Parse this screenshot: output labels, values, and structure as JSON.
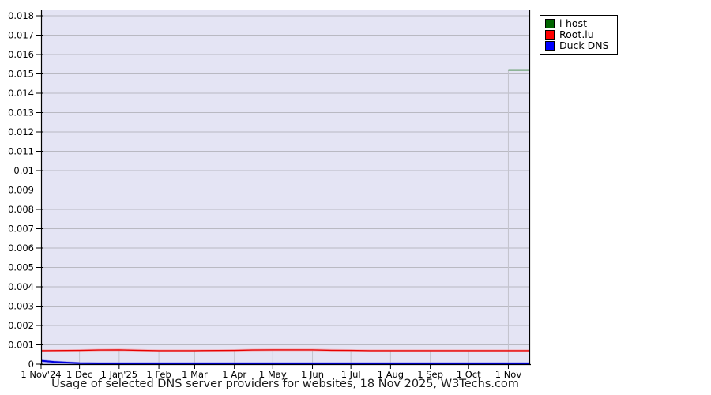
{
  "chart_data": {
    "type": "line",
    "title": "Usage of selected DNS server providers for websites, 18 Nov 2025, W3Techs.com",
    "xlabel": "",
    "ylabel": "",
    "ylim": [
      0,
      0.018
    ],
    "grid": true,
    "legend_position": "top-right",
    "plot_bg": "#e4e4f4",
    "h_grid_color": "#b9b9c2",
    "v_grid_color": "#c3c3cc",
    "axis_color": "#000000",
    "text_color": "#000000",
    "x_total_days": 382,
    "x_ticks": [
      {
        "label": "1 Nov'24",
        "day": 0,
        "grid_top": 0
      },
      {
        "label": "1 Dec",
        "day": 30,
        "grid_top": 0.0007
      },
      {
        "label": "1 Jan'25",
        "day": 61,
        "grid_top": 0.0007
      },
      {
        "label": "1 Feb",
        "day": 92,
        "grid_top": 0.0007
      },
      {
        "label": "1 Mar",
        "day": 120,
        "grid_top": 0.0007
      },
      {
        "label": "1 Apr",
        "day": 151,
        "grid_top": 0.0007
      },
      {
        "label": "1 May",
        "day": 181,
        "grid_top": 0.0007
      },
      {
        "label": "1 Jun",
        "day": 212,
        "grid_top": 0.0007
      },
      {
        "label": "1 Jul",
        "day": 242,
        "grid_top": 0.0007
      },
      {
        "label": "1 Aug",
        "day": 273,
        "grid_top": 0.0007
      },
      {
        "label": "1 Sep",
        "day": 304,
        "grid_top": 0.0007
      },
      {
        "label": "1 Oct",
        "day": 334,
        "grid_top": 0.0007
      },
      {
        "label": "1 Nov",
        "day": 365,
        "grid_top": 0.0152
      }
    ],
    "y_ticks": [
      {
        "label": "0",
        "value": 0
      },
      {
        "label": "0.001",
        "value": 0.001
      },
      {
        "label": "0.002",
        "value": 0.002
      },
      {
        "label": "0.003",
        "value": 0.003
      },
      {
        "label": "0.004",
        "value": 0.004
      },
      {
        "label": "0.005",
        "value": 0.005
      },
      {
        "label": "0.006",
        "value": 0.006
      },
      {
        "label": "0.007",
        "value": 0.007
      },
      {
        "label": "0.008",
        "value": 0.008
      },
      {
        "label": "0.009",
        "value": 0.009
      },
      {
        "label": "0.01",
        "value": 0.01
      },
      {
        "label": "0.011",
        "value": 0.011
      },
      {
        "label": "0.012",
        "value": 0.012
      },
      {
        "label": "0.013",
        "value": 0.013
      },
      {
        "label": "0.014",
        "value": 0.014
      },
      {
        "label": "0.015",
        "value": 0.015
      },
      {
        "label": "0.016",
        "value": 0.016
      },
      {
        "label": "0.017",
        "value": 0.017
      },
      {
        "label": "0.018",
        "value": 0.018
      }
    ],
    "series": [
      {
        "name": "i-host",
        "color": "#006400",
        "points": [
          [
            365,
            0.0152
          ],
          [
            382,
            0.0152
          ]
        ]
      },
      {
        "name": "Root.lu",
        "color": "#e60000",
        "halo": "rgba(255,120,120,0.40)",
        "points": [
          [
            0,
            0.0007
          ],
          [
            30,
            0.00071
          ],
          [
            45,
            0.00073
          ],
          [
            61,
            0.00074
          ],
          [
            75,
            0.00072
          ],
          [
            92,
            0.0007
          ],
          [
            120,
            0.0007
          ],
          [
            151,
            0.00071
          ],
          [
            165,
            0.00073
          ],
          [
            181,
            0.00074
          ],
          [
            212,
            0.00074
          ],
          [
            227,
            0.00072
          ],
          [
            242,
            0.00071
          ],
          [
            257,
            0.0007
          ],
          [
            273,
            0.0007
          ],
          [
            304,
            0.0007
          ],
          [
            334,
            0.0007
          ],
          [
            365,
            0.0007
          ],
          [
            382,
            0.0007
          ]
        ]
      },
      {
        "name": "Duck DNS",
        "color": "#0000dd",
        "halo": "rgba(110,110,245,0.45)",
        "fill": "rgba(130,130,245,0.30)",
        "points": [
          [
            0,
            0.00018
          ],
          [
            10,
            0.00012
          ],
          [
            20,
            8e-05
          ],
          [
            30,
            5e-05
          ],
          [
            45,
            4e-05
          ],
          [
            61,
            4e-05
          ],
          [
            92,
            4e-05
          ],
          [
            120,
            4e-05
          ],
          [
            151,
            4e-05
          ],
          [
            181,
            4e-05
          ],
          [
            212,
            4e-05
          ],
          [
            242,
            4e-05
          ],
          [
            273,
            4e-05
          ],
          [
            304,
            4e-05
          ],
          [
            334,
            4e-05
          ],
          [
            365,
            4e-05
          ],
          [
            382,
            4e-05
          ]
        ]
      }
    ]
  }
}
